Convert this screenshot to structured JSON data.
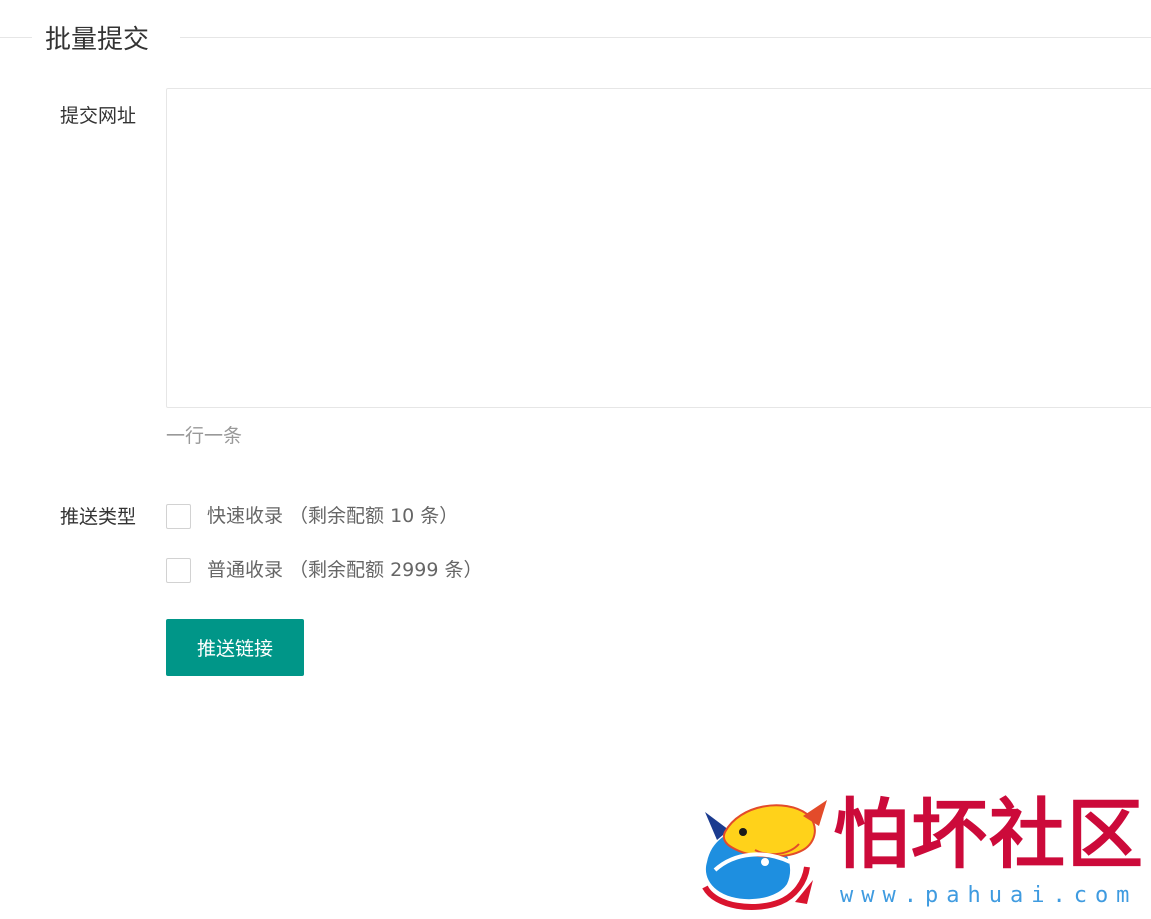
{
  "section": {
    "title": "批量提交"
  },
  "form": {
    "url_label": "提交网址",
    "url_value": "",
    "url_hint": "一行一条",
    "push_type_label": "推送类型",
    "options": [
      {
        "label": "快速收录 （剩余配额 10 条）",
        "checked": false
      },
      {
        "label": "普通收录 （剩余配额 2999 条）",
        "checked": false
      }
    ],
    "submit_label": "推送链接"
  },
  "watermark": {
    "name": "怕坏社区",
    "url": "www.pahuai.com"
  },
  "colors": {
    "primary": "#009688",
    "border": "#e6e6e6",
    "hint": "#999999",
    "watermark_red": "#cc0a3a",
    "watermark_blue": "#3f9be0"
  }
}
